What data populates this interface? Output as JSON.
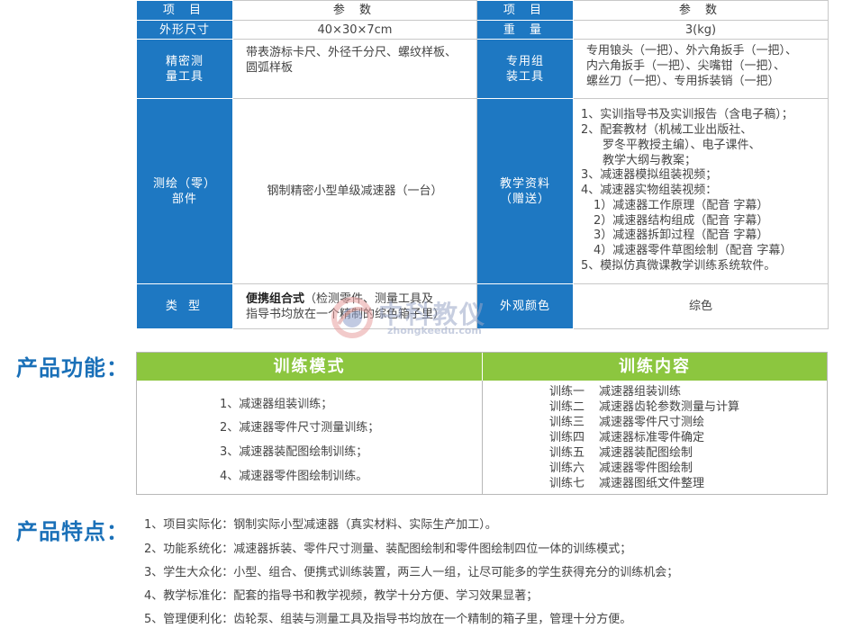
{
  "spec": {
    "header": {
      "item": "项 目",
      "param": "参 数"
    },
    "size_label": "外形尺寸",
    "size_value": "40×30×7cm",
    "weight_label": "重 量",
    "weight_value": "3(kg)",
    "measure_tools_label": [
      "精密测",
      "量工具"
    ],
    "measure_tools_value": [
      "带表游标卡尺、外径千分尺、螺纹样板、",
      "圆弧样板"
    ],
    "assembly_tools_label": [
      "专用组",
      "装工具"
    ],
    "assembly_tools_value": [
      "专用锒头（一把）、外六角扳手（一把）、",
      "内六角扳手（一把）、尖嘴钳（一把）、",
      "螺丝刀（一把）、专用拆装销（一把）"
    ],
    "parts_label": [
      "测绘（零）",
      "部件"
    ],
    "parts_value": "钢制精密小型单级减速器（一台）",
    "materials_label": [
      "教学资料",
      "（赠送）"
    ],
    "materials_value": [
      "1、实训指导书及实训报告（含电子稿）；",
      "2、配套教材（机械工业出版社、",
      "罗冬平教授主编）、电子课件、",
      "教学大纲与教案；",
      "3、减速器模拟组装视频；",
      "4、减速器实物组装视频：",
      "1）减速器工作原理（配音 字幕）",
      "2）减速器结构组成（配音 字幕）",
      "3）减速器拆卸过程（配音 字幕）",
      "4）减速器零件草图绘制（配音 字幕）",
      "5、模拟仿真微课教学训练系统软件。"
    ],
    "type_label": "类 型",
    "type_value_bold": "便携组合式",
    "type_value_rest": "（检测零件、测量工具及",
    "type_value_line2": "指导书均放在一个精制的综色箱子里）",
    "color_label": "外观颜色",
    "color_value": "综色"
  },
  "watermark": {
    "cn": "中科教仪",
    "en": "zhongkeedu.com"
  },
  "functions": {
    "title": "产品功能：",
    "mode_header": "训练模式",
    "content_header": "训练内容",
    "modes": [
      "1、减速器组装训练；",
      "2、减速器零件尺寸测量训练；",
      "3、减速器装配图绘制训练；",
      "4、减速器零件图绘制训练。"
    ],
    "contents": [
      {
        "k": "训练一",
        "v": "减速器组装训练"
      },
      {
        "k": "训练二",
        "v": "减速器齿轮参数测量与计算"
      },
      {
        "k": "训练三",
        "v": "减速器零件尺寸测绘"
      },
      {
        "k": "训练四",
        "v": "减速器标准零件确定"
      },
      {
        "k": "训练五",
        "v": "减速器装配图绘制"
      },
      {
        "k": "训练六",
        "v": "减速器零件图绘制"
      },
      {
        "k": "训练七",
        "v": "减速器图纸文件整理"
      }
    ]
  },
  "features": {
    "title": "产品特点：",
    "items": [
      "1、项目实际化：钢制实际小型减速器（真实材料、实际生产加工）。",
      "2、功能系统化：减速器拆装、零件尺寸测量、装配图绘制和零件图绘制四位一体的训练模式；",
      "3、学生大众化：小型、组合、便携式训练装置，两三人一组，让尽可能多的学生获得充分的训练机会；",
      "4、教学标准化：配套的指导书和教学视频，教学十分方便、学习效果显著；",
      "5、管理便利化：齿轮泵、组装与测量工具及指导书均放在一个精制的箱子里，管理十分方便。"
    ]
  }
}
